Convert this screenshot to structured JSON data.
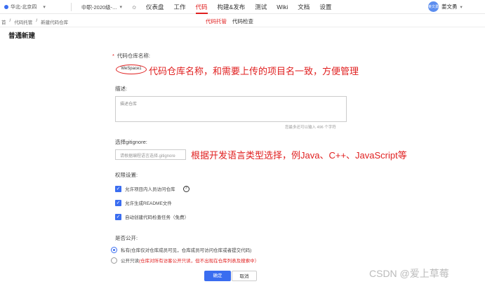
{
  "topbar": {
    "region": "华北-北京四",
    "project": "中职-2020级-...",
    "nav": [
      "仪表盘",
      "工作",
      "代码",
      "构建&发布",
      "测试",
      "Wiki",
      "文档",
      "设置"
    ],
    "active_nav": "代码",
    "user_avatar": "姜文勇",
    "user_name": "姜文勇"
  },
  "breadcrumb": [
    "首",
    "/",
    "代码托管",
    "/",
    "新建代码仓库"
  ],
  "subtabs": [
    "代码托管",
    "代码检查"
  ],
  "page_title": "普通新建",
  "form": {
    "name_label": "代码仓库名称:",
    "name_required": "*",
    "name_value": "WeSpace1",
    "name_annotation": "代码仓库名称，和需要上传的项目名一致，方便管理",
    "desc_label": "描述:",
    "desc_placeholder": "描述仓库",
    "desc_counter": "您最多还可以输入 496 个字符",
    "gitignore_label": "选择gitignore:",
    "gitignore_placeholder": "请根据编程语言选择.gitignore",
    "gitignore_annotation": "根据开发语言类型选择，例Java、C++、JavaScript等",
    "perm_label": "权限设置:",
    "perm_options": [
      "允许项目内人员访问仓库",
      "允许生成README文件",
      "自动创建代码检查任务（免费）"
    ],
    "public_label": "是否公开:",
    "public_private": "私有(仓库仅对仓库成员可见，仓库成员可访问仓库或者提交代码)",
    "public_readonly_prefix": "公开只读",
    "public_readonly_warn": "(仓库对所有访客公开只读，但不出现在仓库列表及搜索中）"
  },
  "buttons": {
    "confirm": "确定",
    "cancel": "取消"
  },
  "watermark": "CSDN @爱上草莓",
  "colors": {
    "accent": "#e02020",
    "primary": "#3a6df0"
  }
}
